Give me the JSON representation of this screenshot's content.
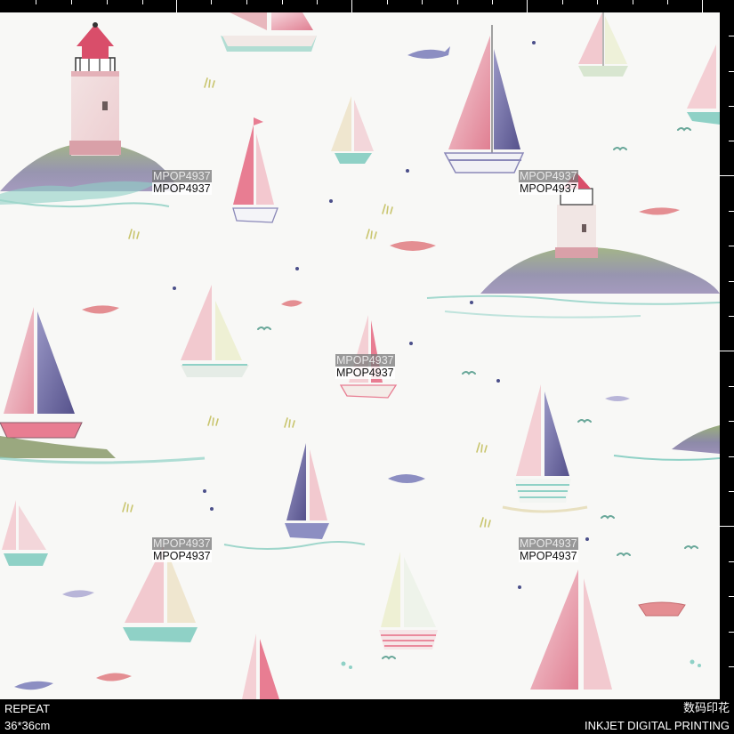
{
  "watermark": "MPOP4937",
  "footer": {
    "left_line1": "REPEAT",
    "left_line2": "36*36cm",
    "right_line1": "数码印花",
    "right_line2": "INKJET DIGITAL PRINTING"
  },
  "colors": {
    "background": "#f8f8f6",
    "pink": "#e58a9a",
    "purple": "#6e6aa0",
    "mint": "#8fd1c6",
    "olive": "#8a9a6a",
    "frame": "#000000"
  },
  "illustration_motifs": [
    "lighthouse-icon",
    "sailboat-icon",
    "island-icon",
    "fish-icon",
    "rowboat-icon",
    "bird-icon",
    "wave-icon"
  ]
}
